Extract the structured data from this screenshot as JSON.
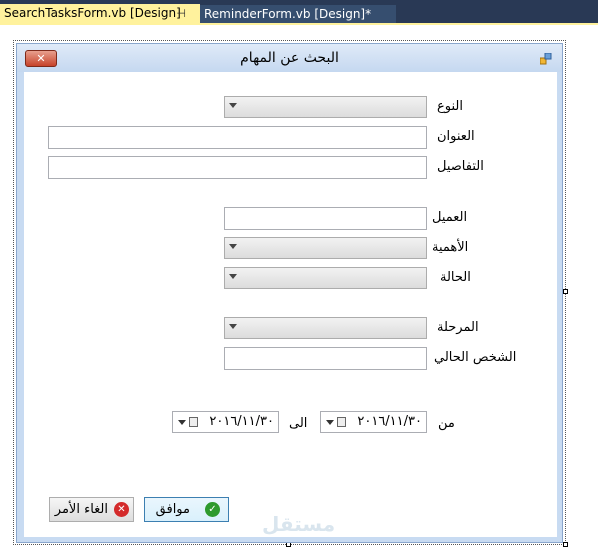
{
  "tabs": {
    "active_label": "SearchTasksForm.vb [Design]",
    "active_pin": "⊣",
    "inactive_label": "ReminderForm.vb [Design]*"
  },
  "form": {
    "title": "البحث عن المهام",
    "close_label": "✕"
  },
  "fields": {
    "type_label": "النوع",
    "title_label": "العنوان",
    "details_label": "التفاصيل",
    "client_label": "العميل",
    "priority_label": "الأهمية",
    "status_label": "الحالة",
    "stage_label": "المرحلة",
    "current_person_label": "الشخص الحالي",
    "from_label": "من",
    "to_label": "الى",
    "from_date": "٢٠١٦/١١/٣٠",
    "to_date": "٢٠١٦/١١/٣٠"
  },
  "buttons": {
    "ok_label": "موافق",
    "cancel_label": "الغاء الأمر"
  },
  "watermark": "مستقل",
  "colors": {
    "ok_icon": "#2e9a2e",
    "cancel_icon": "#d42a2a",
    "active_tab": "#fff29d",
    "tab_strip": "#293955"
  }
}
